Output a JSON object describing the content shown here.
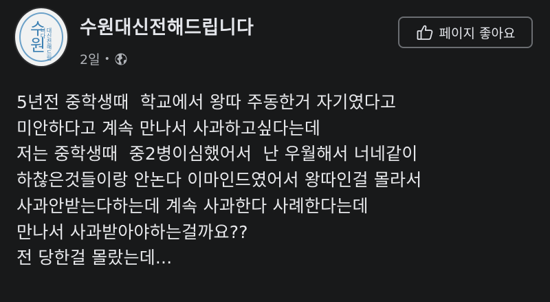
{
  "post": {
    "page_name": "수원대신전해드립니다",
    "timestamp": "2일",
    "separator": "•",
    "privacy_icon": "globe-icon",
    "like_page_button": "페이지 좋아요",
    "like_icon": "thumbs-up-icon",
    "avatar": {
      "main_text": "수\n원",
      "sub_text": "대신전해드립니다"
    },
    "message_lines": [
      "5년전 중학생때  학교에서 왕따 주동한거 자기였다고",
      "미안하다고 계속 만나서 사과하고싶다는데",
      "저는 중학생때  중2병이심했어서  난 우월해서 너네같이",
      "하찮은것들이랑 안논다 이마인드였어서 왕따인걸 몰라서",
      "사과안받는다하는데 계속 사과한다 사례한다는데",
      "만나서 사과받아야하는걸까요??",
      "전 당한걸 몰랐는데..."
    ]
  },
  "colors": {
    "background": "#18191a",
    "primary_text": "#e4e6eb",
    "secondary_text": "#b0b3b8",
    "button_border": "#6b6e72",
    "avatar_accent": "#3a7fb2"
  }
}
